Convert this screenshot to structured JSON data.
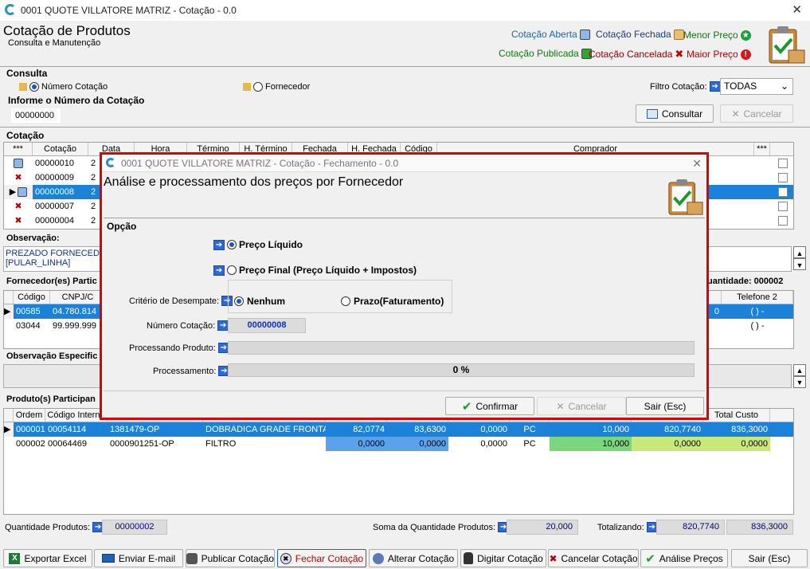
{
  "window": {
    "title": "0001 QUOTE VILLATORE MATRIZ - Cotação - 0.0",
    "close": "✕"
  },
  "header": {
    "title": "Cotação de Produtos",
    "subtitle": "Consulta e Manutenção"
  },
  "legend": {
    "aberta": "Cotação Aberta",
    "fechada": "Cotação Fechada",
    "menor": "Menor Preço",
    "publicada": "Cotação Publicada",
    "cancelada": "Cotação Cancelada",
    "maior": "Maior Preço"
  },
  "colors": {
    "accent": "#1c82d9",
    "modal_border": "#e00000",
    "green_cell": "#7cd67c",
    "blue_cell": "#5aa3ea"
  },
  "consulta": {
    "title": "Consulta",
    "opt_numero": "Número Cotação",
    "opt_fornecedor": "Fornecedor",
    "filtro_label": "Filtro Cotação:",
    "filtro_value": "TODAS",
    "informe_label": "Informe o Número da Cotação",
    "numero_value": "00000000",
    "consultar": "Consultar",
    "cancelar": "Cancelar"
  },
  "cotacao": {
    "title": "Cotação",
    "columns": [
      "***",
      "Cotação",
      "Data",
      "Hora",
      "Término",
      "H. Término",
      "Fechada",
      "H. Fechada",
      "Código",
      "Comprador",
      "***"
    ],
    "rows": [
      {
        "status": "aberta",
        "num": "00000010",
        "tail": "2"
      },
      {
        "status": "cancelada",
        "num": "00000009",
        "tail": "2"
      },
      {
        "status": "aberta",
        "num": "00000008",
        "tail": "2"
      },
      {
        "status": "cancelada",
        "num": "00000007",
        "tail": "2"
      },
      {
        "status": "cancelada",
        "num": "00000004",
        "tail": "2"
      }
    ]
  },
  "observacao": {
    "title": "Observação:",
    "text1": "PREZADO FORNECEDOR",
    "text2": "[PULAR_LINHA]"
  },
  "fornecedores": {
    "title": "Fornecedor(es) Partic",
    "qty_label": "uantidade: 000002",
    "columns": [
      "Código",
      "CNPJ/C",
      "Telefone 2"
    ],
    "rows": [
      {
        "code": "00585",
        "cnpj": "04.780.814",
        "tail": "0",
        "tel": "( )  -"
      },
      {
        "code": "03044",
        "cnpj": "99.999.999",
        "tail": "",
        "tel": "( )  -"
      }
    ]
  },
  "obs_especifica": {
    "title": "Observação Especific"
  },
  "produtos": {
    "title": "Produto(s) Participan",
    "columns": [
      "Ordem",
      "Código Interno",
      "",
      "",
      "",
      "",
      "",
      "",
      "",
      "",
      "Total Custo"
    ],
    "rows": [
      {
        "ordem": "000001",
        "cod": "00054114",
        "ref": "1381479-OP",
        "desc": "DOBRADICA GRADE FRONTAL",
        "v1": "82,0774",
        "v2": "83,6300",
        "v3": "0,0000",
        "un": "PC",
        "qtd": "10,000",
        "v4": "820,7740",
        "total": "836,3000"
      },
      {
        "ordem": "000002",
        "cod": "00064469",
        "ref": "0000901251-OP",
        "desc": "FILTRO",
        "v1": "0,0000",
        "v2": "0,0000",
        "v3": "0,0000",
        "un": "PC",
        "qtd": "10,000",
        "v4": "0,0000",
        "total": "0,0000"
      }
    ]
  },
  "totals": {
    "qtd_label": "Quantidade Produtos:",
    "qtd_value": "00000002",
    "soma_label": "Soma da Quantidade Produtos:",
    "soma_value": "20,000",
    "tot_label": "Totalizando:",
    "tot_value1": "820,7740",
    "tot_value2": "836,3000"
  },
  "toolbar": {
    "exportar": "Exportar Excel",
    "email": "Enviar E-mail",
    "publicar": "Publicar Cotação",
    "fechar": "Fechar Cotação",
    "alterar": "Alterar Cotação",
    "digitar": "Digitar Cotação",
    "cancelar": "Cancelar Cotação",
    "analise": "Análise Preços",
    "sair": "Sair (Esc)"
  },
  "modal": {
    "title": "0001 QUOTE VILLATORE MATRIZ - Cotação - Fechamento - 0.0",
    "heading": "Análise e processamento dos preços por Fornecedor",
    "opcao": "Opção",
    "preco_liquido": "Preço Líquido",
    "preco_final": "Preço Final (Preço Líquido + Impostos)",
    "criterio_label": "Critério de Desempate:",
    "nenhum": "Nenhum",
    "prazo": "Prazo(Faturamento)",
    "numero_label": "Número Cotação:",
    "numero_value": "00000008",
    "processando_label": "Processando Produto:",
    "processamento_label": "Processamento:",
    "progress_text": "0 %",
    "progress": 0,
    "confirmar": "Confirmar",
    "cancelar": "Cancelar",
    "sair": "Sair (Esc)"
  }
}
